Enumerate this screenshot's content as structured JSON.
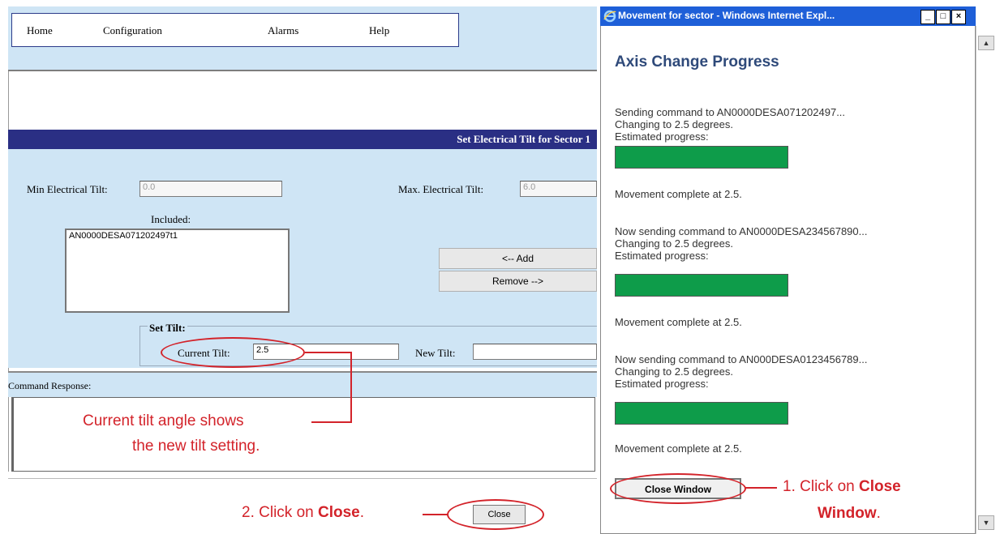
{
  "nav": {
    "items": [
      "Home",
      "Configuration",
      "Alarms",
      "Help"
    ]
  },
  "main": {
    "section_title": "Set Electrical Tilt for Sector 1",
    "min_tilt_label": "Min Electrical Tilt:",
    "min_tilt_value": "0.0",
    "max_tilt_label": "Max. Electrical Tilt:",
    "max_tilt_value": "6.0",
    "included_label": "Included:",
    "included_items": [
      "AN0000DESA071202497t1"
    ],
    "add_button": "<-- Add",
    "remove_button": "Remove -->",
    "set_tilt_legend": "Set Tilt:",
    "current_tilt_label": "Current Tilt:",
    "current_tilt_value": "2.5",
    "new_tilt_label": "New Tilt:",
    "new_tilt_value": "",
    "command_response_label": "Command Response:",
    "close_button": "Close"
  },
  "popup": {
    "window_title": "Movement for sector - Windows Internet Expl...",
    "heading": "Axis Change Progress",
    "estimated_label": "Estimated progress:",
    "blocks": [
      {
        "sending": "Sending command to AN0000DESA071202497...",
        "changing": "Changing to 2.5 degrees.",
        "complete": "Movement complete at 2.5.",
        "progress": 1.0
      },
      {
        "sending": "Now sending command to AN0000DESA234567890...",
        "changing": "Changing to 2.5 degrees.",
        "complete": "Movement complete at 2.5.",
        "progress": 1.0
      },
      {
        "sending": "Now sending command to AN000DESA0123456789...",
        "changing": "Changing to 2.5 degrees.",
        "complete": "Movement complete at 2.5.",
        "progress": 1.0
      }
    ],
    "close_window_button": "Close Window"
  },
  "annotations": {
    "current_tilt_note_line1": "Current tilt angle shows",
    "current_tilt_note_line2": "the new tilt setting.",
    "step2_prefix": "2.  Click on ",
    "step2_bold": "Close",
    "step2_suffix": ".",
    "step1_prefix": "1.  Click on ",
    "step1_bold_a": "Close",
    "step1_bold_b": "Window",
    "step1_suffix": "."
  },
  "colors": {
    "annotation": "#d3232a",
    "title_band": "#2a2f84",
    "progress_fill": "#0e9c4a",
    "page_band": "#cfe5f5"
  },
  "icons": {
    "ie_logo": "ie-icon",
    "minimize": "minimize-icon",
    "maximize": "maximize-icon",
    "close": "close-icon"
  }
}
